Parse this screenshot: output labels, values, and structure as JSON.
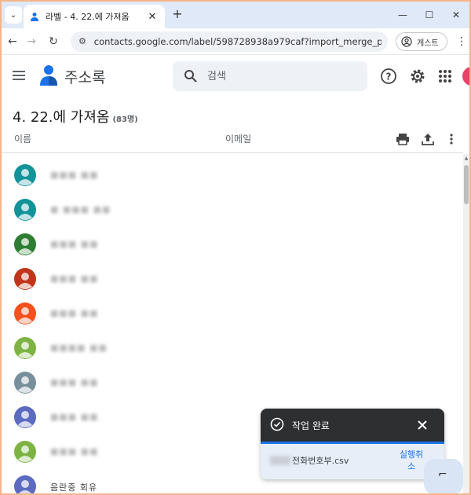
{
  "browser": {
    "tab_title": "라벨 - 4. 22.에 가져옴",
    "url": "contacts.google.com/label/598728938a979caf?import_merge_promo&h...",
    "guest_label": "게스트"
  },
  "app": {
    "name": "주소록",
    "search_placeholder": "검색"
  },
  "label": {
    "title": "4. 22.에 가져옴",
    "count": "(83명)"
  },
  "columns": {
    "name": "이름",
    "email": "이메일"
  },
  "contacts": [
    {
      "name": "■■■ ■■",
      "color": "#12939a"
    },
    {
      "name": "■ ■■■ ■■",
      "color": "#12939a"
    },
    {
      "name": "■■■ ■■",
      "color": "#2e7d32"
    },
    {
      "name": "■■■ ■■",
      "color": "#c1351a"
    },
    {
      "name": "■■■ ■■",
      "color": "#f4511e"
    },
    {
      "name": "■■■■ ■■",
      "color": "#7cb342"
    },
    {
      "name": "■■■ ■■",
      "color": "#78909c"
    },
    {
      "name": "■■■ ■■",
      "color": "#5c6bc0"
    },
    {
      "name": "■■■ ■■",
      "color": "#7cb342"
    },
    {
      "name": "음란중 회유",
      "color": "#5c6bc0"
    }
  ],
  "snackbar": {
    "title": "작업 완료",
    "file": "전화번호부.csv",
    "undo": "실행취\n소"
  },
  "colors": {
    "accent": "#1a73e8",
    "snackbar_dark": "#2d2f31",
    "frame": "#f6b48a"
  }
}
